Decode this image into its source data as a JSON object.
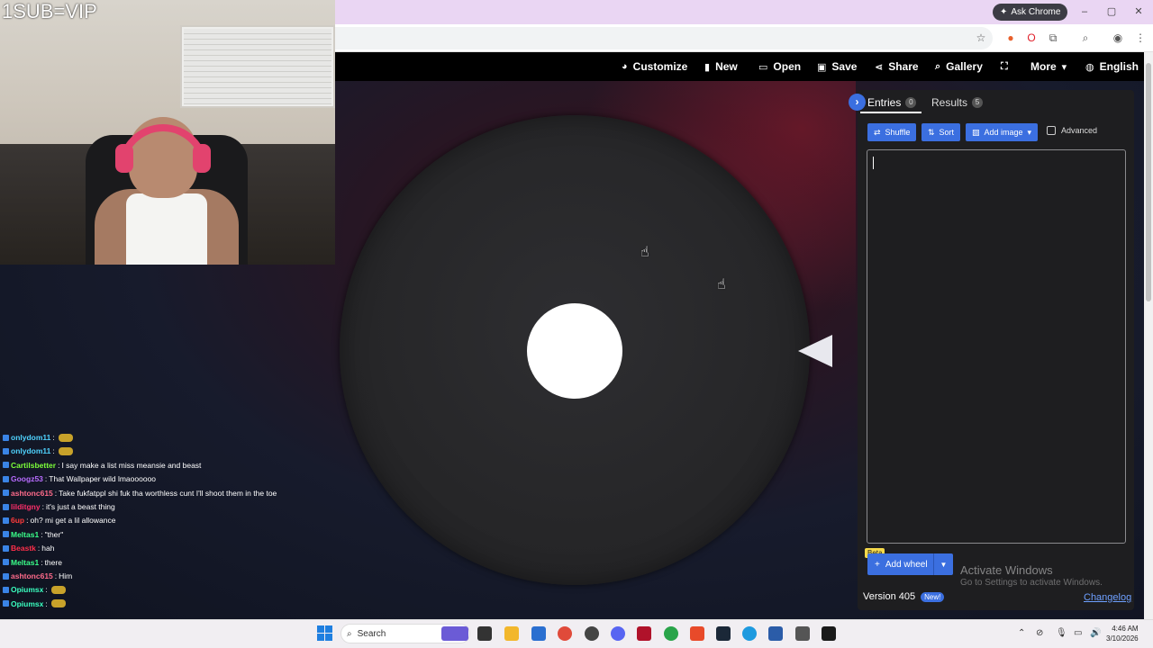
{
  "browser": {
    "ask_chrome": "Ask Chrome",
    "window_controls": [
      "–",
      "▢",
      "✕"
    ]
  },
  "nav": {
    "customize": "Customize",
    "new": "New",
    "open": "Open",
    "save": "Save",
    "share": "Share",
    "gallery": "Gallery",
    "more": "More",
    "language": "English"
  },
  "panel": {
    "tabs": [
      {
        "label": "Entries",
        "count": "0"
      },
      {
        "label": "Results",
        "count": "5"
      }
    ],
    "shuffle": "Shuffle",
    "sort": "Sort",
    "add_image": "Add image",
    "advanced": "Advanced",
    "beta": "Beta",
    "add_wheel": "Add wheel",
    "version": "Version 405",
    "new_badge": "New!",
    "changelog": "Changelog"
  },
  "windows_activation": {
    "title": "Activate Windows",
    "subtitle": "Go to Settings to activate Windows."
  },
  "stream": {
    "overlay_text": "1SUB=VIP",
    "chat": [
      {
        "name": "onlydom11",
        "color": "#4fd3ff",
        "msg": "",
        "emote": true
      },
      {
        "name": "onlydom11",
        "color": "#4fd3ff",
        "msg": "",
        "emote": true
      },
      {
        "name": "Cartilsbetter",
        "color": "#7cff3a",
        "msg": "I say make a list miss meansie and beast",
        "emote": false
      },
      {
        "name": "Googz53",
        "color": "#b86cff",
        "msg": "That Wallpaper wild lmaoooooo",
        "emote": false
      },
      {
        "name": "ashtonc615",
        "color": "#ff6b8b",
        "msg": "Take fukfatppl shi fuk tha worthless cunt I'll shoot them in the toe",
        "emote": false
      },
      {
        "name": "lilditgny",
        "color": "#ff2f6a",
        "msg": "it's just a beast thing",
        "emote": false
      },
      {
        "name": "6up",
        "color": "#ff3b3b",
        "msg": "oh? mi get a lil allowance",
        "emote": false
      },
      {
        "name": "Meltas1",
        "color": "#3aff8a",
        "msg": "\"ther\"",
        "emote": false
      },
      {
        "name": "Beastk",
        "color": "#ff2f4a",
        "msg": "hah",
        "emote": false
      },
      {
        "name": "Meltas1",
        "color": "#3aff8a",
        "msg": "there",
        "emote": false
      },
      {
        "name": "ashtonc615",
        "color": "#ff6b8b",
        "msg": "Him",
        "emote": false
      },
      {
        "name": "Opiumsx",
        "color": "#3affc0",
        "msg": "",
        "emote": true
      },
      {
        "name": "Opiumsx",
        "color": "#3affc0",
        "msg": "",
        "emote": true
      }
    ]
  },
  "taskbar": {
    "search": "Search",
    "time": "4:46 AM",
    "date": "3/10/2026"
  },
  "colors": {
    "accent": "#3b6fe0",
    "panel_bg": "#1e1e20",
    "nav_bg": "#000000"
  }
}
